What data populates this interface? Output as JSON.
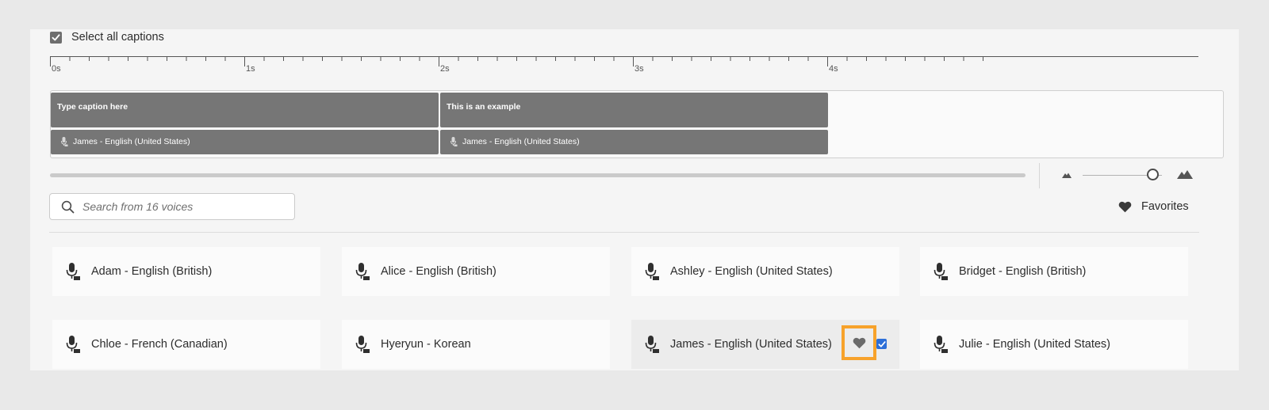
{
  "select_all": {
    "label": "Select all captions",
    "checked": true
  },
  "ruler": {
    "labels": [
      "0s",
      "1s",
      "2s",
      "3s",
      "4s"
    ]
  },
  "captions": [
    {
      "text": "Type caption here",
      "voice": "James - English (United States)"
    },
    {
      "text": "This is an example",
      "voice": "James - English (United States)"
    }
  ],
  "search": {
    "placeholder": "Search from 16 voices",
    "value": ""
  },
  "favorites": {
    "label": "Favorites",
    "icon": "heart-icon"
  },
  "voices": [
    {
      "name": "Adam - English (British)",
      "icon": "microphone-icon"
    },
    {
      "name": "Alice - English (British)",
      "icon": "microphone-icon"
    },
    {
      "name": "Ashley - English (United States)",
      "icon": "microphone-icon"
    },
    {
      "name": "Bridget - English (British)",
      "icon": "microphone-icon"
    },
    {
      "name": "Chloe - French (Canadian)",
      "icon": "microphone-icon"
    },
    {
      "name": "Hyeryun - Korean",
      "icon": "microphone-icon"
    },
    {
      "name": "James - English (United States)",
      "icon": "microphone-icon",
      "selected": true,
      "favorite_highlighted": true
    },
    {
      "name": "Julie - English (United States)",
      "icon": "microphone-icon"
    }
  ],
  "colors": {
    "highlight": "#f7a22b",
    "checkbox_blue": "#2d6fd8",
    "clip": "#767676"
  }
}
